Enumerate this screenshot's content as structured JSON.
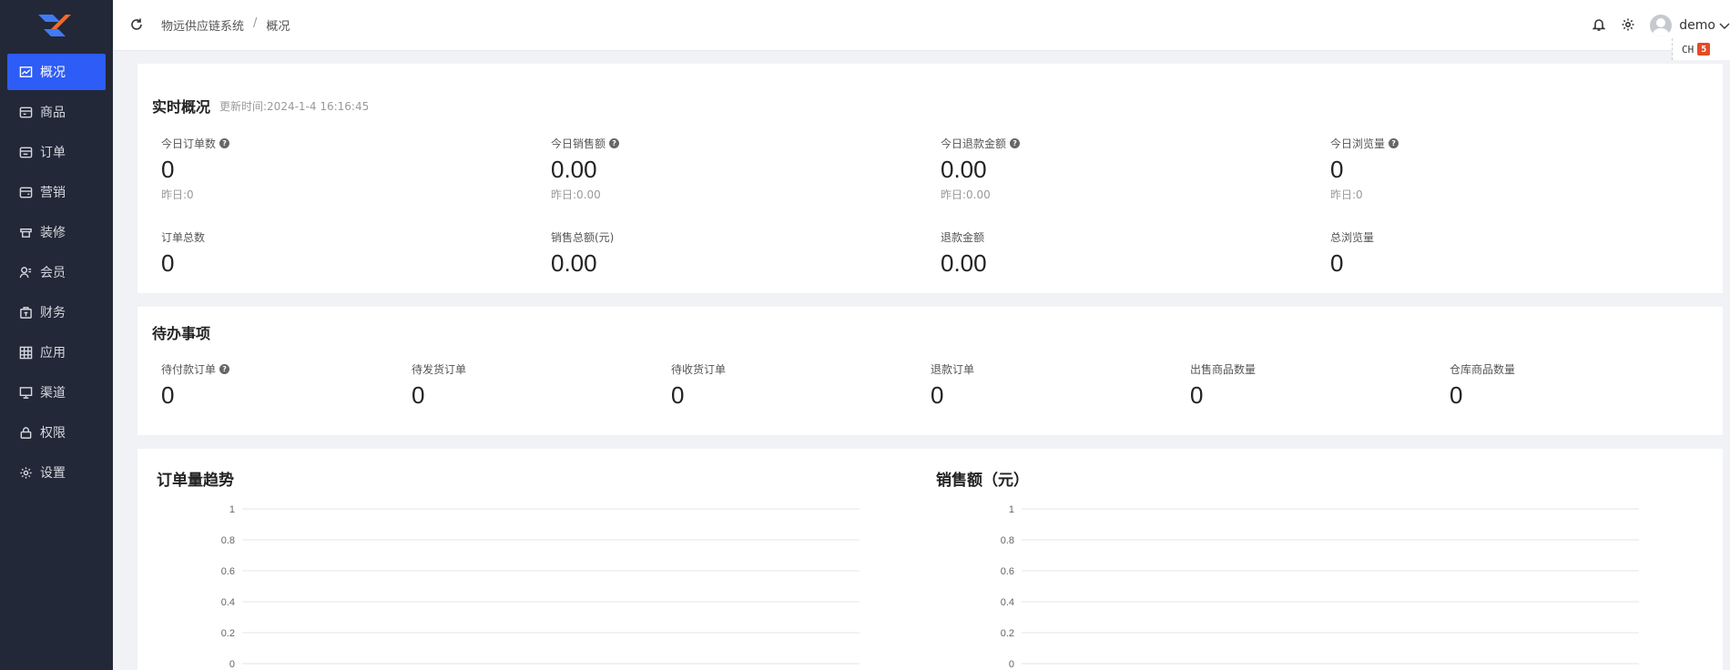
{
  "sidebar": {
    "items": [
      {
        "label": "概况",
        "icon": "chart-line-icon",
        "active": true
      },
      {
        "label": "商品",
        "icon": "goods-icon"
      },
      {
        "label": "订单",
        "icon": "order-icon"
      },
      {
        "label": "营销",
        "icon": "marketing-icon"
      },
      {
        "label": "装修",
        "icon": "decoration-icon"
      },
      {
        "label": "会员",
        "icon": "member-icon"
      },
      {
        "label": "财务",
        "icon": "finance-icon"
      },
      {
        "label": "应用",
        "icon": "apps-icon"
      },
      {
        "label": "渠道",
        "icon": "channel-icon"
      },
      {
        "label": "权限",
        "icon": "lock-icon"
      },
      {
        "label": "设置",
        "icon": "gear-icon"
      }
    ]
  },
  "header": {
    "breadcrumb": [
      "物远供应链系统",
      "概况"
    ],
    "separator": "/",
    "username": "demo",
    "lang": "CH"
  },
  "realtime": {
    "title": "实时概况",
    "update_time": "更新时间:2024-1-4 16:16:45",
    "today": [
      {
        "label": "今日订单数",
        "value": "0",
        "yesterday": "昨日:0"
      },
      {
        "label": "今日销售额",
        "value": "0.00",
        "yesterday": "昨日:0.00"
      },
      {
        "label": "今日退款金额",
        "value": "0.00",
        "yesterday": "昨日:0.00"
      },
      {
        "label": "今日浏览量",
        "value": "0",
        "yesterday": "昨日:0"
      }
    ],
    "totals": [
      {
        "label": "订单总数",
        "value": "0"
      },
      {
        "label": "销售总额(元)",
        "value": "0.00"
      },
      {
        "label": "退款金额",
        "value": "0.00"
      },
      {
        "label": "总浏览量",
        "value": "0"
      }
    ]
  },
  "todo": {
    "title": "待办事项",
    "items": [
      {
        "label": "待付款订单",
        "value": "0",
        "help": true
      },
      {
        "label": "待发货订单",
        "value": "0"
      },
      {
        "label": "待收货订单",
        "value": "0"
      },
      {
        "label": "退款订单",
        "value": "0"
      },
      {
        "label": "出售商品数量",
        "value": "0"
      },
      {
        "label": "仓库商品数量",
        "value": "0"
      }
    ]
  },
  "chart_data": [
    {
      "type": "line",
      "title": "订单量趋势",
      "ylim": [
        0,
        1
      ],
      "yticks": [
        "1",
        "0.8",
        "0.6",
        "0.4",
        "0.2",
        "0"
      ],
      "series": [],
      "grid": true
    },
    {
      "type": "line",
      "title": "销售额（元）",
      "ylim": [
        0,
        1
      ],
      "yticks": [
        "1",
        "0.8",
        "0.6",
        "0.4",
        "0.2",
        "0"
      ],
      "series": [],
      "grid": true
    }
  ]
}
